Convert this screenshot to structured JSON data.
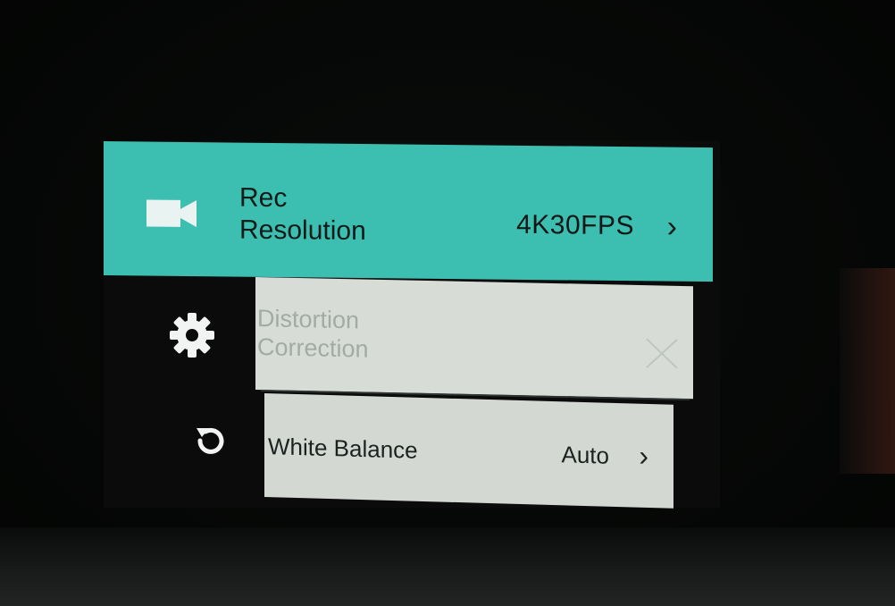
{
  "colors": {
    "accent": "#3cbfb0",
    "row_background": "#d3d8d3",
    "disabled_text": "#a3aaa6",
    "text": "#1b2220"
  },
  "sidebar": {
    "items": [
      {
        "icon": "video-camera-icon"
      },
      {
        "icon": "gear-icon"
      },
      {
        "icon": "reset-icon"
      }
    ]
  },
  "menu": {
    "items": [
      {
        "label_line1": "Rec",
        "label_line2": "Resolution",
        "value": "4K30FPS",
        "chevron": "›",
        "state": "selected"
      },
      {
        "label_line1": "Distortion",
        "label_line2": "Correction",
        "value_icon": "x-icon",
        "state": "disabled"
      },
      {
        "label": "White Balance",
        "value": "Auto",
        "chevron": "›",
        "state": "normal"
      }
    ]
  }
}
